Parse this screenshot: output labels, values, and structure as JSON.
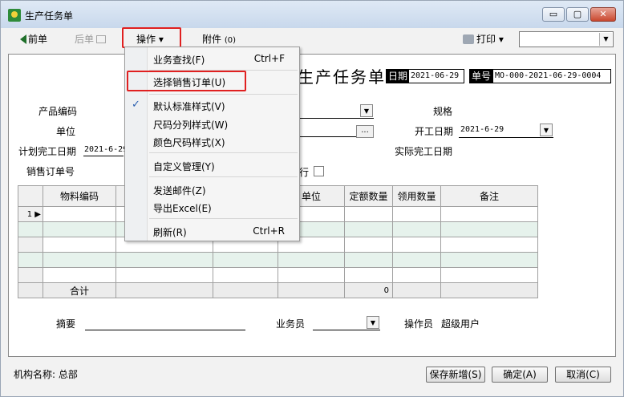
{
  "window": {
    "title": "生产任务单",
    "minimize": "▭",
    "maximize": "▢",
    "close": "✕"
  },
  "toolbar": {
    "prev": "前单",
    "next": "后单",
    "operate": "操作",
    "attach": "附件",
    "attach_count": "(0)",
    "print": "打印",
    "caret": "▾",
    "print_select_value": ""
  },
  "doc": {
    "title": "生产任务单",
    "date_label": "日期",
    "date_value": "2021-06-29",
    "number_label": "单号",
    "number_value": "MO-000-2021-06-29-0004",
    "fields": {
      "product_code": "产品编码",
      "spec": "规格",
      "unit": "单位",
      "start_date_label": "开工日期",
      "start_date_value": "2021-6-29",
      "planned_finish": "计划完工日期",
      "planned_finish_value": "2021-6-29",
      "actual_finish": "实际完工日期",
      "sales_order_no": "销售订单号",
      "row_suffix": "行",
      "ellipsis": "..."
    },
    "grid": {
      "headers": [
        "物料编码",
        "",
        "",
        "单位",
        "定额数量",
        "领用数量",
        "备注"
      ],
      "row1_marker": "1 ▶",
      "total_label": "合计",
      "total_value": "0"
    },
    "summary_label": "摘要",
    "salesman_label": "业务员",
    "operator_label": "操作员",
    "operator_value": "超级用户"
  },
  "menu": {
    "items": [
      {
        "label": "业务查找(F)",
        "shortcut": "Ctrl+F"
      },
      {
        "label": "选择销售订单(U)",
        "shortcut": ""
      },
      {
        "label": "默认标准样式(V)",
        "shortcut": "",
        "checked": true
      },
      {
        "label": "尺码分列样式(W)",
        "shortcut": ""
      },
      {
        "label": "颜色尺码样式(X)",
        "shortcut": ""
      },
      {
        "label": "自定义管理(Y)",
        "shortcut": ""
      },
      {
        "label": "发送邮件(Z)",
        "shortcut": ""
      },
      {
        "label": "导出Excel(E)",
        "shortcut": ""
      },
      {
        "label": "刷新(R)",
        "shortcut": "Ctrl+R"
      }
    ],
    "check_glyph": "✓"
  },
  "footer": {
    "org_label": "机构名称: 总部",
    "save_new": "保存新增(S)",
    "ok": "确定(A)",
    "cancel": "取消(C)"
  },
  "colors": {
    "highlight": "#e02020",
    "accent_green": "#2e8b3a"
  }
}
